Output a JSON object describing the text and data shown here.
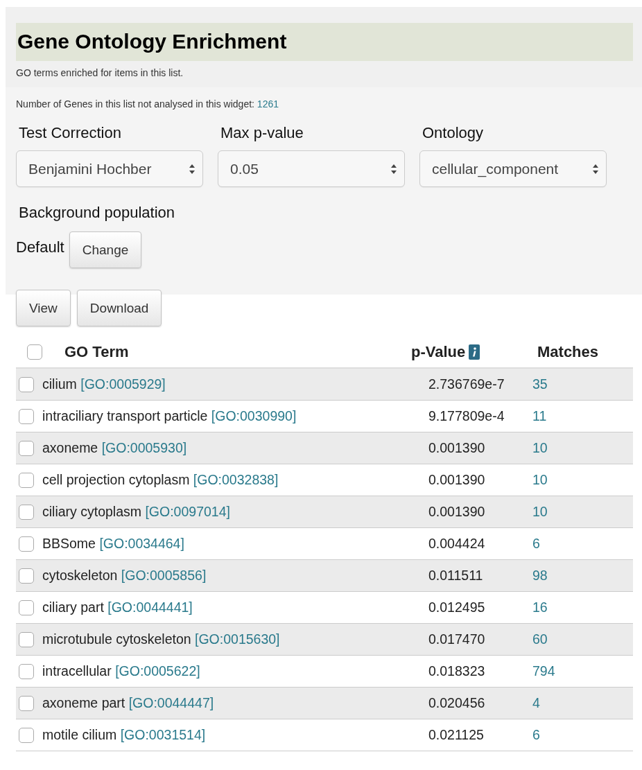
{
  "title": "Gene Ontology Enrichment",
  "subtitle": "GO terms enriched for items in this list.",
  "not_analysed": {
    "label": "Number of Genes in this list not analysed in this widget:",
    "count": "1261"
  },
  "filters": [
    {
      "label": "Test Correction",
      "value": "Benjamini Hochber"
    },
    {
      "label": "Max p-value",
      "value": "0.05"
    },
    {
      "label": "Ontology",
      "value": "cellular_component"
    }
  ],
  "background": {
    "label": "Background population",
    "value": "Default",
    "button": "Change"
  },
  "buttons": [
    "View",
    "Download"
  ],
  "table": {
    "select_all_checked": false,
    "columns": [
      "GO Term",
      "p-Value",
      "Matches"
    ],
    "rows": [
      {
        "checked": false,
        "term": "cilium",
        "go_id": "[GO:0005929]",
        "p_value": "2.736769e-7",
        "matches": "35"
      },
      {
        "checked": false,
        "term": "intraciliary transport particle",
        "go_id": "[GO:0030990]",
        "p_value": "9.177809e-4",
        "matches": "11"
      },
      {
        "checked": false,
        "term": "axoneme",
        "go_id": "[GO:0005930]",
        "p_value": "0.001390",
        "matches": "10"
      },
      {
        "checked": false,
        "term": "cell projection cytoplasm",
        "go_id": "[GO:0032838]",
        "p_value": "0.001390",
        "matches": "10"
      },
      {
        "checked": false,
        "term": "ciliary cytoplasm",
        "go_id": "[GO:0097014]",
        "p_value": "0.001390",
        "matches": "10"
      },
      {
        "checked": false,
        "term": "BBSome",
        "go_id": "[GO:0034464]",
        "p_value": "0.004424",
        "matches": "6"
      },
      {
        "checked": false,
        "term": "cytoskeleton",
        "go_id": "[GO:0005856]",
        "p_value": "0.011511",
        "matches": "98"
      },
      {
        "checked": false,
        "term": "ciliary part",
        "go_id": "[GO:0044441]",
        "p_value": "0.012495",
        "matches": "16"
      },
      {
        "checked": false,
        "term": "microtubule cytoskeleton",
        "go_id": "[GO:0015630]",
        "p_value": "0.017470",
        "matches": "60"
      },
      {
        "checked": false,
        "term": "intracellular",
        "go_id": "[GO:0005622]",
        "p_value": "0.018323",
        "matches": "794"
      },
      {
        "checked": false,
        "term": "axoneme part",
        "go_id": "[GO:0044447]",
        "p_value": "0.020456",
        "matches": "4"
      },
      {
        "checked": false,
        "term": "motile cilium",
        "go_id": "[GO:0031514]",
        "p_value": "0.021125",
        "matches": "6"
      }
    ]
  }
}
